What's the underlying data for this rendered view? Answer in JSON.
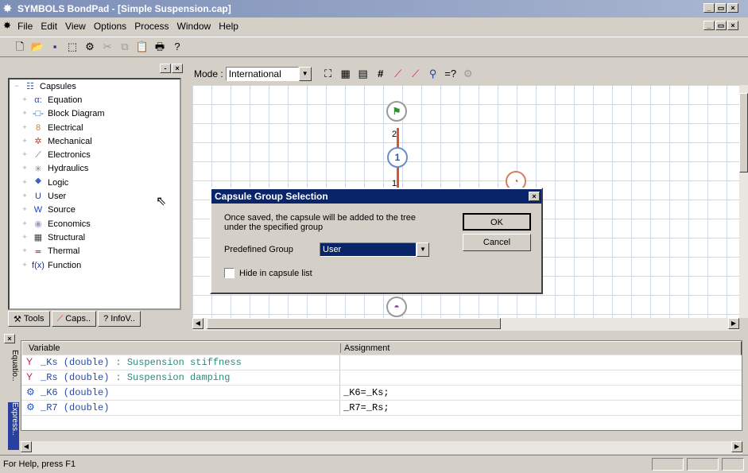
{
  "window": {
    "title": "SYMBOLS BondPad - [Simple Suspension.cap]"
  },
  "menu": [
    "File",
    "Edit",
    "View",
    "Options",
    "Process",
    "Window",
    "Help"
  ],
  "toolbar": {
    "icons": [
      "new-icon",
      "open-icon",
      "save-icon",
      "select-icon",
      "capsule-icon",
      "cut-icon",
      "copy-icon",
      "paste-icon",
      "print-icon",
      "help-icon"
    ]
  },
  "mode": {
    "label": "Mode :",
    "value": "International"
  },
  "tree": {
    "root": "Capsules",
    "items": [
      {
        "label": "Equation",
        "icon": "α:",
        "color": "#3050a0"
      },
      {
        "label": "Block Diagram",
        "icon": "-□-",
        "color": "#2050c0"
      },
      {
        "label": "Electrical",
        "icon": "8",
        "color": "#c09020"
      },
      {
        "label": "Mechanical",
        "icon": "✲",
        "color": "#c04040"
      },
      {
        "label": "Electronics",
        "icon": "⟋",
        "color": "#606060"
      },
      {
        "label": "Hydraulics",
        "icon": "✳",
        "color": "#808080"
      },
      {
        "label": "Logic",
        "icon": "⯁",
        "color": "#4060c0"
      },
      {
        "label": "User",
        "icon": "U",
        "color": "#2040a0"
      },
      {
        "label": "Source",
        "icon": "W",
        "color": "#2040c0"
      },
      {
        "label": "Economics",
        "icon": "◉",
        "color": "#a0a0c0"
      },
      {
        "label": "Structural",
        "icon": "▦",
        "color": "#404040"
      },
      {
        "label": "Thermal",
        "icon": "≖",
        "color": "#c03020"
      },
      {
        "label": "Function",
        "icon": "f(x)",
        "color": "#203080"
      }
    ]
  },
  "tabs": [
    "Tools",
    "Caps..",
    "InfoV.."
  ],
  "canvas": {
    "node_labels": [
      "2",
      "1",
      "1"
    ]
  },
  "dialog": {
    "title": "Capsule Group Selection",
    "message": "Once saved, the capsule will be added to the tree under the specified group",
    "group_label": "Predefined Group",
    "group_value": "User",
    "ok": "OK",
    "cancel": "Cancel",
    "hide_label": "Hide in capsule list"
  },
  "variables": {
    "headers": [
      "Variable",
      "Assignment"
    ],
    "side_tabs": [
      "Equatio..",
      "Express.."
    ],
    "rows": [
      {
        "name": "_Ks (double)",
        "comment": ": Suspension stiffness",
        "assignment": ""
      },
      {
        "name": "_Rs (double)",
        "comment": ": Suspension damping",
        "assignment": ""
      },
      {
        "name": "_K6 (double)",
        "comment": "",
        "assignment": "_K6=_Ks;"
      },
      {
        "name": "_R7 (double)",
        "comment": "",
        "assignment": "_R7=_Rs;"
      }
    ]
  },
  "status": "For Help, press F1"
}
